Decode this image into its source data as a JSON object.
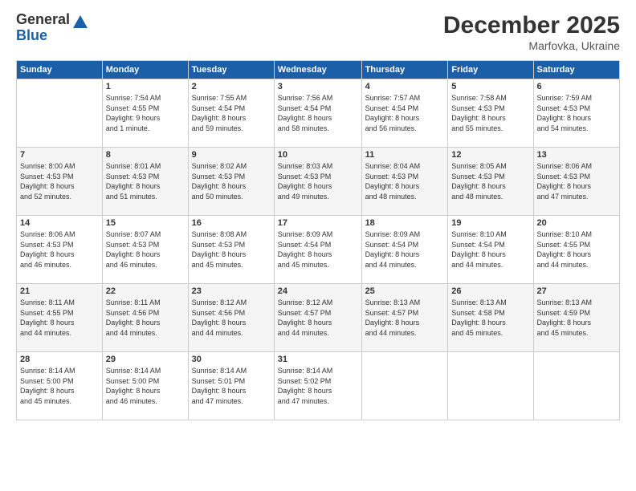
{
  "logo": {
    "general": "General",
    "blue": "Blue"
  },
  "header": {
    "month": "December 2025",
    "location": "Marfovka, Ukraine"
  },
  "weekdays": [
    "Sunday",
    "Monday",
    "Tuesday",
    "Wednesday",
    "Thursday",
    "Friday",
    "Saturday"
  ],
  "weeks": [
    [
      {
        "day": "",
        "info": ""
      },
      {
        "day": "1",
        "info": "Sunrise: 7:54 AM\nSunset: 4:55 PM\nDaylight: 9 hours\nand 1 minute."
      },
      {
        "day": "2",
        "info": "Sunrise: 7:55 AM\nSunset: 4:54 PM\nDaylight: 8 hours\nand 59 minutes."
      },
      {
        "day": "3",
        "info": "Sunrise: 7:56 AM\nSunset: 4:54 PM\nDaylight: 8 hours\nand 58 minutes."
      },
      {
        "day": "4",
        "info": "Sunrise: 7:57 AM\nSunset: 4:54 PM\nDaylight: 8 hours\nand 56 minutes."
      },
      {
        "day": "5",
        "info": "Sunrise: 7:58 AM\nSunset: 4:53 PM\nDaylight: 8 hours\nand 55 minutes."
      },
      {
        "day": "6",
        "info": "Sunrise: 7:59 AM\nSunset: 4:53 PM\nDaylight: 8 hours\nand 54 minutes."
      }
    ],
    [
      {
        "day": "7",
        "info": "Sunrise: 8:00 AM\nSunset: 4:53 PM\nDaylight: 8 hours\nand 52 minutes."
      },
      {
        "day": "8",
        "info": "Sunrise: 8:01 AM\nSunset: 4:53 PM\nDaylight: 8 hours\nand 51 minutes."
      },
      {
        "day": "9",
        "info": "Sunrise: 8:02 AM\nSunset: 4:53 PM\nDaylight: 8 hours\nand 50 minutes."
      },
      {
        "day": "10",
        "info": "Sunrise: 8:03 AM\nSunset: 4:53 PM\nDaylight: 8 hours\nand 49 minutes."
      },
      {
        "day": "11",
        "info": "Sunrise: 8:04 AM\nSunset: 4:53 PM\nDaylight: 8 hours\nand 48 minutes."
      },
      {
        "day": "12",
        "info": "Sunrise: 8:05 AM\nSunset: 4:53 PM\nDaylight: 8 hours\nand 48 minutes."
      },
      {
        "day": "13",
        "info": "Sunrise: 8:06 AM\nSunset: 4:53 PM\nDaylight: 8 hours\nand 47 minutes."
      }
    ],
    [
      {
        "day": "14",
        "info": "Sunrise: 8:06 AM\nSunset: 4:53 PM\nDaylight: 8 hours\nand 46 minutes."
      },
      {
        "day": "15",
        "info": "Sunrise: 8:07 AM\nSunset: 4:53 PM\nDaylight: 8 hours\nand 46 minutes."
      },
      {
        "day": "16",
        "info": "Sunrise: 8:08 AM\nSunset: 4:53 PM\nDaylight: 8 hours\nand 45 minutes."
      },
      {
        "day": "17",
        "info": "Sunrise: 8:09 AM\nSunset: 4:54 PM\nDaylight: 8 hours\nand 45 minutes."
      },
      {
        "day": "18",
        "info": "Sunrise: 8:09 AM\nSunset: 4:54 PM\nDaylight: 8 hours\nand 44 minutes."
      },
      {
        "day": "19",
        "info": "Sunrise: 8:10 AM\nSunset: 4:54 PM\nDaylight: 8 hours\nand 44 minutes."
      },
      {
        "day": "20",
        "info": "Sunrise: 8:10 AM\nSunset: 4:55 PM\nDaylight: 8 hours\nand 44 minutes."
      }
    ],
    [
      {
        "day": "21",
        "info": "Sunrise: 8:11 AM\nSunset: 4:55 PM\nDaylight: 8 hours\nand 44 minutes."
      },
      {
        "day": "22",
        "info": "Sunrise: 8:11 AM\nSunset: 4:56 PM\nDaylight: 8 hours\nand 44 minutes."
      },
      {
        "day": "23",
        "info": "Sunrise: 8:12 AM\nSunset: 4:56 PM\nDaylight: 8 hours\nand 44 minutes."
      },
      {
        "day": "24",
        "info": "Sunrise: 8:12 AM\nSunset: 4:57 PM\nDaylight: 8 hours\nand 44 minutes."
      },
      {
        "day": "25",
        "info": "Sunrise: 8:13 AM\nSunset: 4:57 PM\nDaylight: 8 hours\nand 44 minutes."
      },
      {
        "day": "26",
        "info": "Sunrise: 8:13 AM\nSunset: 4:58 PM\nDaylight: 8 hours\nand 45 minutes."
      },
      {
        "day": "27",
        "info": "Sunrise: 8:13 AM\nSunset: 4:59 PM\nDaylight: 8 hours\nand 45 minutes."
      }
    ],
    [
      {
        "day": "28",
        "info": "Sunrise: 8:14 AM\nSunset: 5:00 PM\nDaylight: 8 hours\nand 45 minutes."
      },
      {
        "day": "29",
        "info": "Sunrise: 8:14 AM\nSunset: 5:00 PM\nDaylight: 8 hours\nand 46 minutes."
      },
      {
        "day": "30",
        "info": "Sunrise: 8:14 AM\nSunset: 5:01 PM\nDaylight: 8 hours\nand 47 minutes."
      },
      {
        "day": "31",
        "info": "Sunrise: 8:14 AM\nSunset: 5:02 PM\nDaylight: 8 hours\nand 47 minutes."
      },
      {
        "day": "",
        "info": ""
      },
      {
        "day": "",
        "info": ""
      },
      {
        "day": "",
        "info": ""
      }
    ]
  ]
}
